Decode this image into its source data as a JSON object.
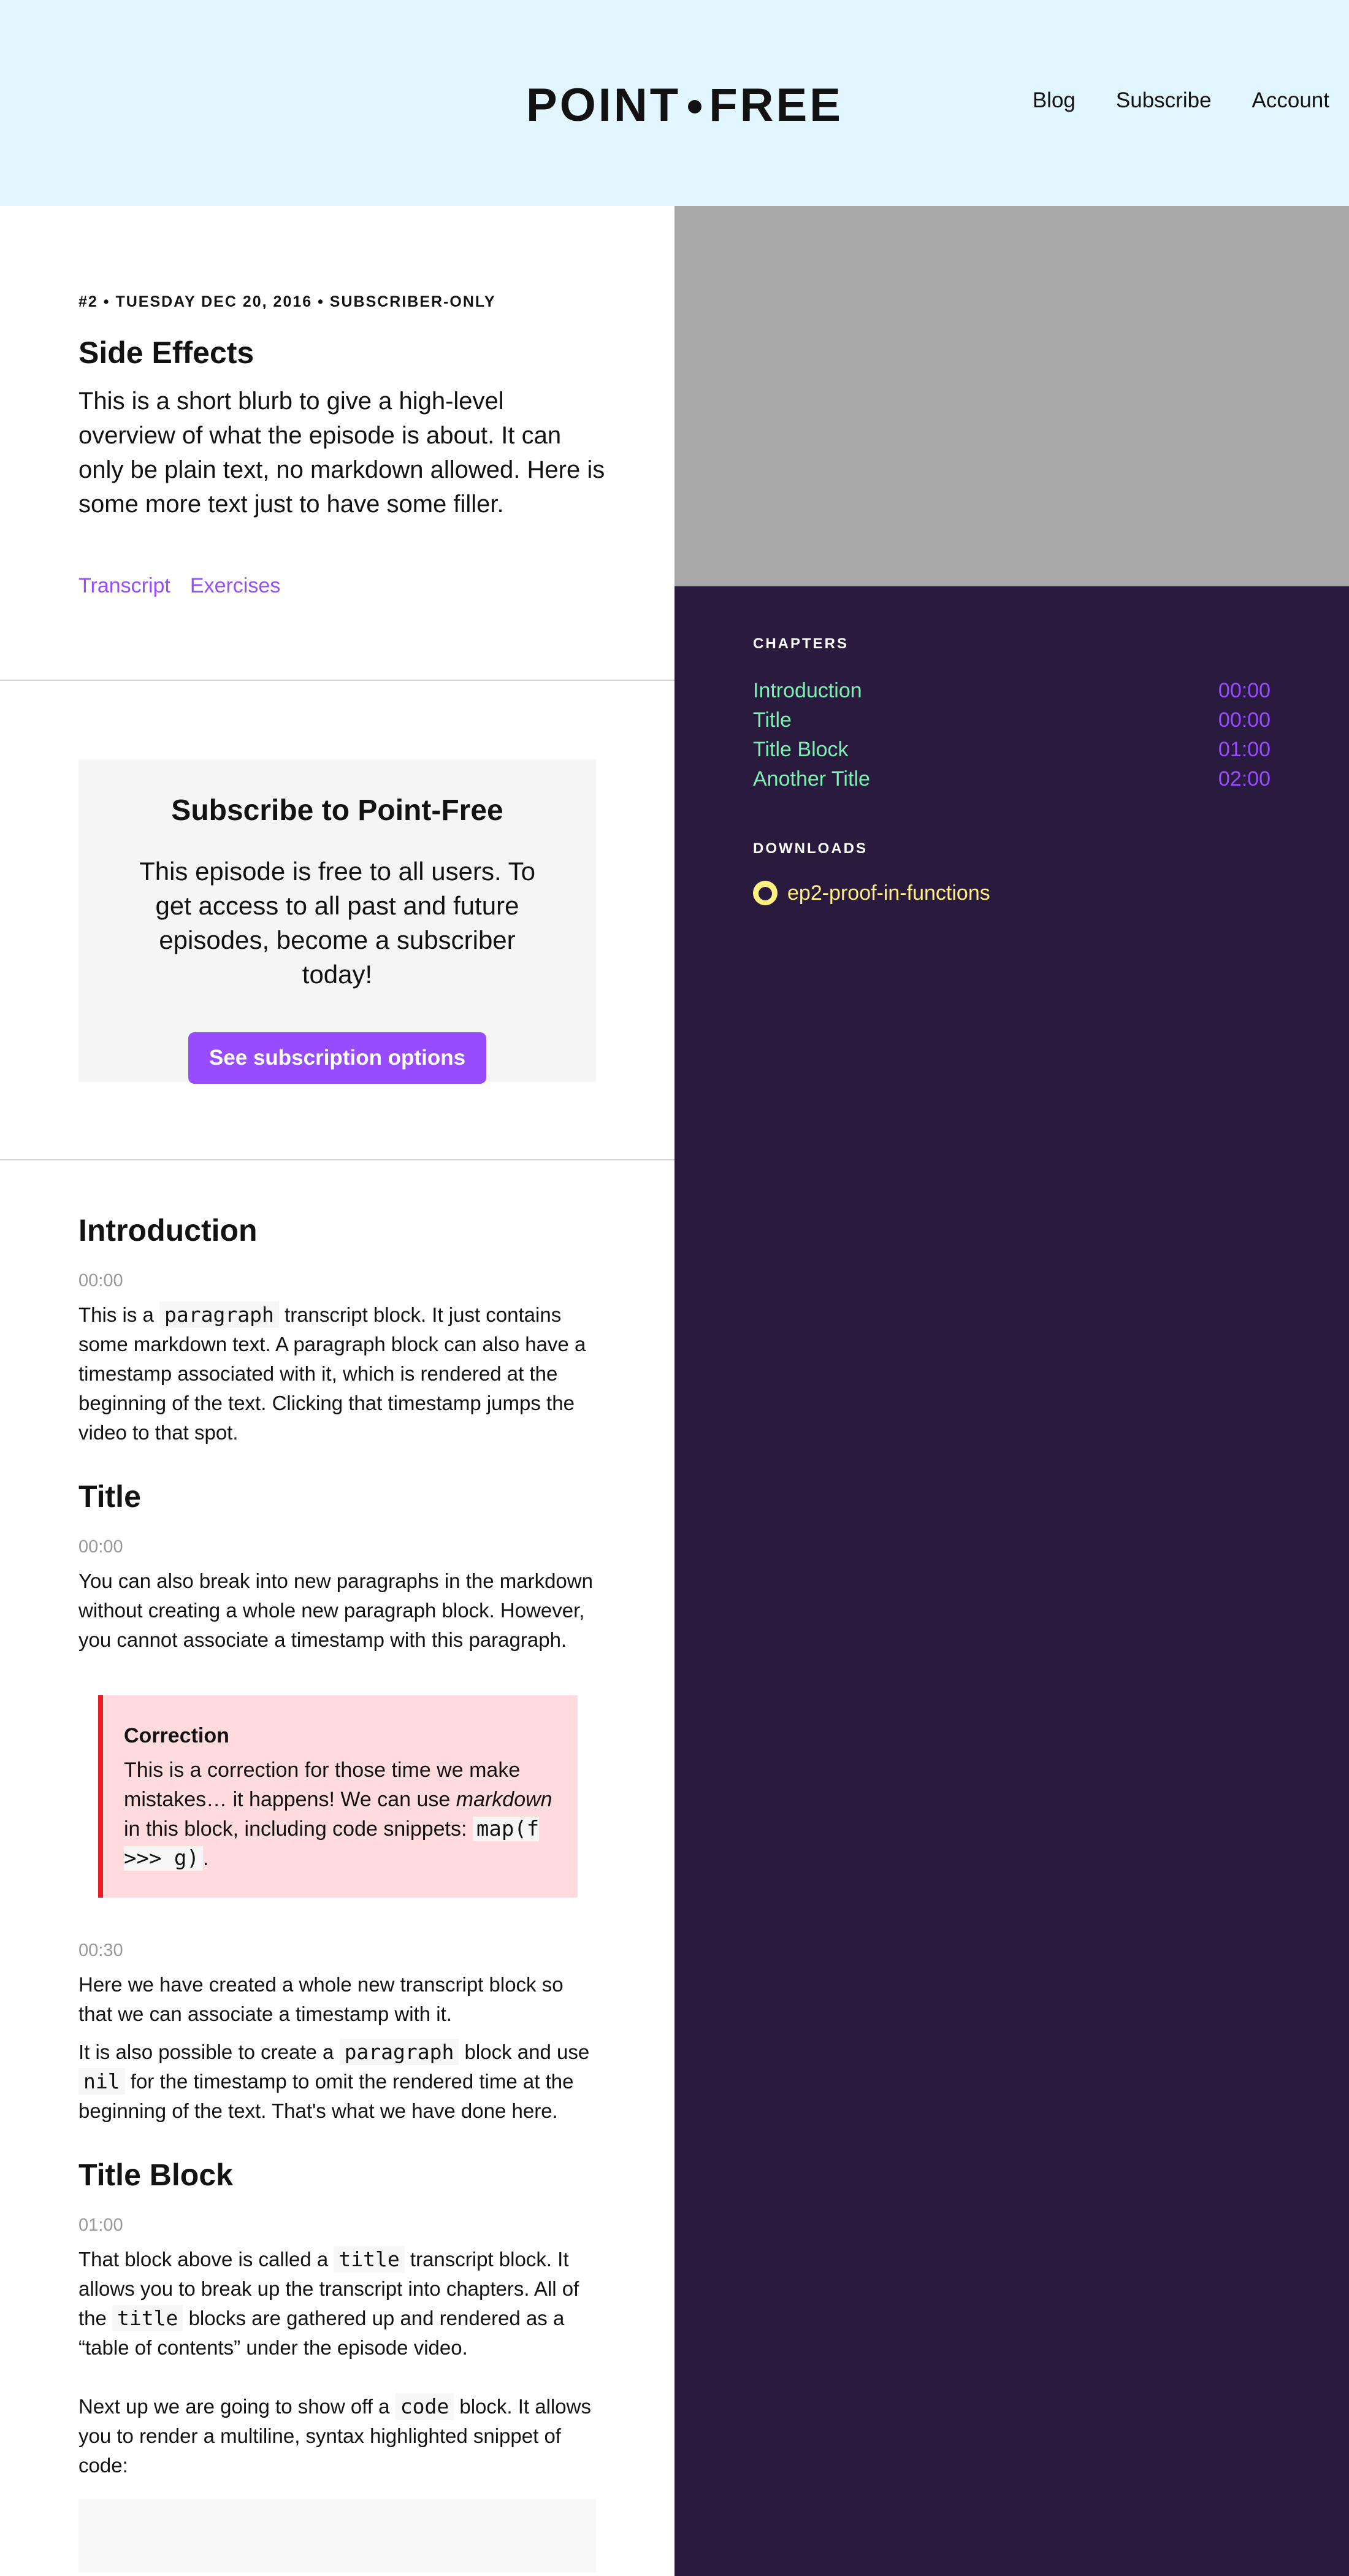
{
  "header": {
    "logo_left": "POINT",
    "logo_right": "FREE",
    "nav": [
      "Blog",
      "Subscribe",
      "Account"
    ]
  },
  "episode": {
    "meta": "#2 • TUESDAY DEC 20, 2016 • SUBSCRIBER-ONLY",
    "title": "Side Effects",
    "blurb": "This is a short blurb to give a high-level overview of what the episode is about. It can only be plain text, no markdown allowed. Here is some more text just to have some filler.",
    "links": [
      "Transcript",
      "Exercises"
    ]
  },
  "subscribe": {
    "title": "Subscribe to Point-Free",
    "text": "This episode is free to all users. To get access to all past and future episodes, become a subscriber today!",
    "button": "See subscription options"
  },
  "transcript": {
    "intro": {
      "title": "Introduction",
      "time": "00:00",
      "p_a": "This is a",
      "p_code": "paragraph",
      "p_b": "transcript block. It just contains some markdown text. A paragraph block can also have a timestamp associated with it, which is rendered at the beginning of the text. Clicking that timestamp jumps the video to that spot."
    },
    "title_section": {
      "title": "Title",
      "time": "00:00",
      "p": "You can also break into new paragraphs in the markdown without creating a whole new paragraph block. However, you cannot associate a timestamp with this paragraph."
    },
    "correction": {
      "title": "Correction",
      "body_a": "This is a correction for those time we make mistakes… it happens! We can use",
      "body_em": "markdown",
      "body_b": "in this block, including code snippets:",
      "body_code": "map(f >>> g)",
      "body_c": "."
    },
    "block_0030": {
      "time": "00:30",
      "p1": "Here we have created a whole new transcript block so that we can associate a timestamp with it.",
      "p2_a": "It is also possible to create a",
      "p2_code1": "paragraph",
      "p2_b": "block and use",
      "p2_code2": "nil",
      "p2_c": "for the timestamp to omit the rendered time at the beginning of the text. That's what we have done here."
    },
    "title_block": {
      "title": "Title Block",
      "time": "01:00",
      "p1_a": "That block above is called a",
      "p1_code1": "title",
      "p1_b": "transcript block. It allows you to break up the transcript into chapters. All of the",
      "p1_code2": "title",
      "p1_c": "blocks are gathered up and rendered as a “table of contents” under the episode video.",
      "p2_a": "Next up we are going to show off a",
      "p2_code": "code",
      "p2_b": "block. It allows you to render a multiline, syntax highlighted snippet of code:"
    }
  },
  "sidebar": {
    "chapters_heading": "CHAPTERS",
    "chapters": [
      {
        "name": "Introduction",
        "time": "00:00"
      },
      {
        "name": "Title",
        "time": "00:00"
      },
      {
        "name": "Title Block",
        "time": "01:00"
      },
      {
        "name": "Another Title",
        "time": "02:00"
      }
    ],
    "downloads_heading": "DOWNLOADS",
    "download_link": "ep2-proof-in-functions",
    "download_icon": "github-icon"
  },
  "colors": {
    "header_bg": "#e2f6ff",
    "accent_purple": "#974dff",
    "sidebar_bg": "#291a3e",
    "chapter_green": "#79f2b0",
    "download_yellow": "#fff080",
    "correction_bg": "#ffdbdd",
    "correction_border": "#eb1c26"
  }
}
